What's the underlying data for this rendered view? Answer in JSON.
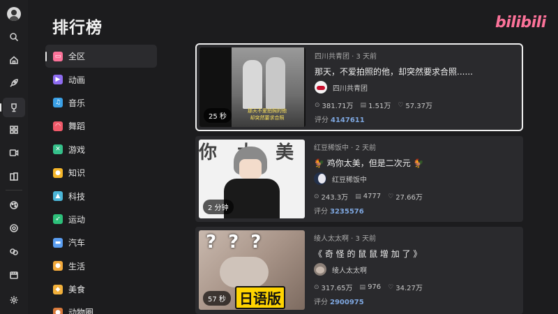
{
  "page": {
    "title": "排行榜",
    "logo": "bilibili"
  },
  "rail": {
    "icons": [
      "search-icon",
      "home-icon",
      "rocket-icon",
      "trophy-icon",
      "grid-icon",
      "video-icon",
      "collection-icon",
      "palette-icon",
      "live-icon",
      "game-icon",
      "film-icon",
      "settings-icon"
    ]
  },
  "categories": [
    {
      "label": "全区",
      "color": "#fb7299",
      "selected": true
    },
    {
      "label": "动画",
      "color": "#8e6cf0"
    },
    {
      "label": "音乐",
      "color": "#3aa0e6"
    },
    {
      "label": "舞蹈",
      "color": "#f05a6a"
    },
    {
      "label": "游戏",
      "color": "#35c08a"
    },
    {
      "label": "知识",
      "color": "#f5b62a"
    },
    {
      "label": "科技",
      "color": "#4bb6d8"
    },
    {
      "label": "运动",
      "color": "#2dc07a"
    },
    {
      "label": "汽车",
      "color": "#5a9ef2"
    },
    {
      "label": "生活",
      "color": "#f2a93b"
    },
    {
      "label": "美食",
      "color": "#f2b03b"
    },
    {
      "label": "动物圈",
      "color": "#d97a3b"
    }
  ],
  "videos": [
    {
      "uploader_time": "四川共青团 · 3 天前",
      "title": "那天，不爱拍照的他，却突然要求合照......",
      "uploader": "四川共青团",
      "views": "381.71万",
      "danmaku": "1.51万",
      "likes": "57.37万",
      "score_label": "评分",
      "score": "4147611",
      "duration": "25 秒",
      "thumb_caption": "那天不爱拍照的他\n却突然要求合照",
      "focused": true
    },
    {
      "uploader_time": "红豆稀饭中 · 2 天前",
      "title": "🐓 鸡你太美，但是二次元 🐓",
      "uploader": "红豆稀饭中",
      "views": "243.3万",
      "danmaku": "4777",
      "likes": "27.66万",
      "score_label": "评分",
      "score": "3235576",
      "duration": "2 分钟",
      "thumb_caption": "你 太 美"
    },
    {
      "uploader_time": "绫人太太啊 · 3 天前",
      "title": "《 奇 怪 的 鼠 鼠 增 加 了 》",
      "uploader": "绫人太太啊",
      "views": "317.65万",
      "danmaku": "976",
      "likes": "34.27万",
      "score_label": "评分",
      "score": "2900975",
      "duration": "57 秒",
      "thumb_caption": "日语版",
      "thumb_marks": "? ? ?"
    }
  ]
}
